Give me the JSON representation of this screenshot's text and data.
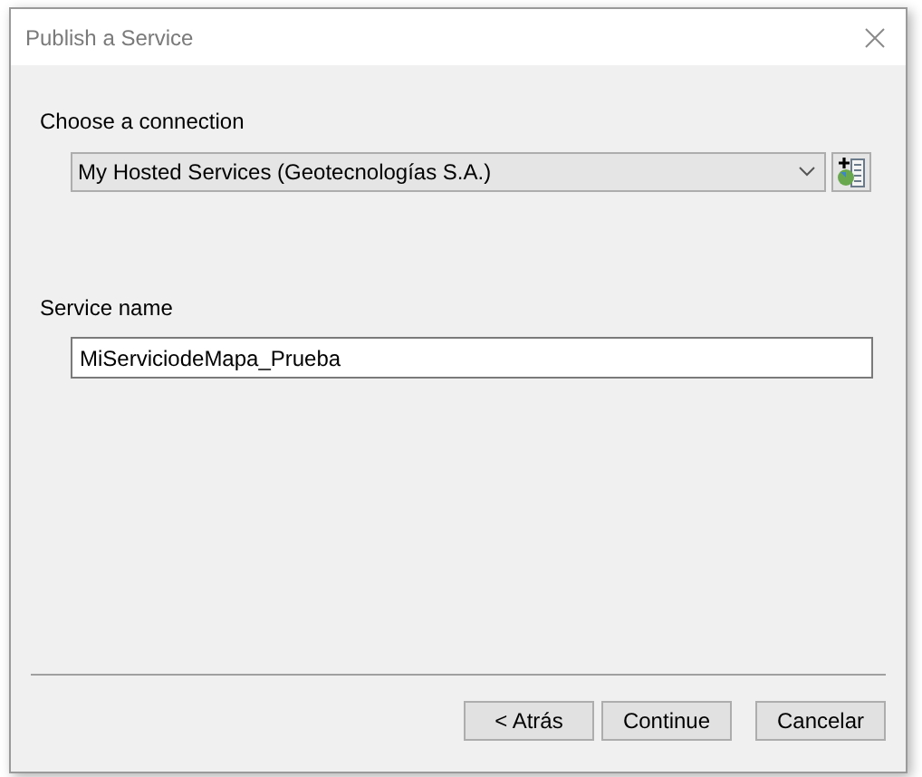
{
  "window": {
    "title": "Publish a Service"
  },
  "connection": {
    "label": "Choose a connection",
    "value": "My Hosted Services (Geotecnologías S.A.)"
  },
  "service_name": {
    "label": "Service name",
    "value": "MiServiciodeMapa_Prueba"
  },
  "buttons": [
    {
      "label": "< Atrás",
      "kind": "back"
    },
    {
      "label": "Continue",
      "kind": "primary"
    },
    {
      "label": "Cancelar",
      "kind": "cancel"
    }
  ]
}
